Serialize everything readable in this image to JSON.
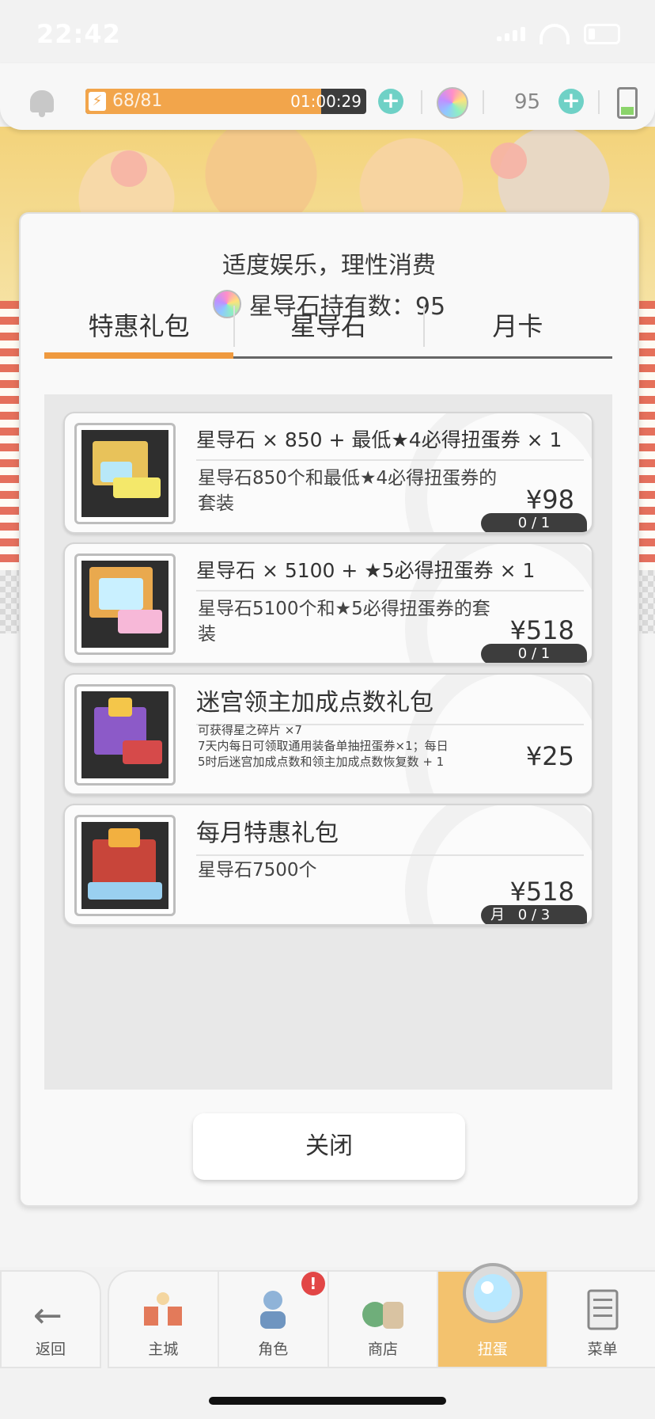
{
  "status_bar": {
    "time": "22:42"
  },
  "resources": {
    "stamina_text": "68/81",
    "stamina_fraction": 0.84,
    "stamina_timer": "01:00:29",
    "gem_count": "95"
  },
  "modal": {
    "notice": "适度娱乐，理性消费",
    "holding_label": "星导石持有数：95",
    "tabs": [
      {
        "label": "特惠礼包",
        "active": true
      },
      {
        "label": "星导石",
        "active": false
      },
      {
        "label": "月卡",
        "active": false
      }
    ],
    "items": [
      {
        "title": "星导石 × 850 + 最低★4必得扭蛋券 × 1",
        "desc": "星导石850个和最低★4必得扭蛋券的套装",
        "price": "¥98",
        "limit": "0 / 1",
        "limit_prefix": ""
      },
      {
        "title": "星导石 × 5100 + ★5必得扭蛋券 × 1",
        "desc": "星导石5100个和★5必得扭蛋券的套装",
        "price": "¥518",
        "limit": "0 / 1",
        "limit_prefix": ""
      },
      {
        "title": "迷宫领主加成点数礼包",
        "desc_lines": [
          "可获得星之碎片 ×7",
          "7天内每日可领取通用装备单抽扭蛋券×1；每日",
          "5时后迷宫加成点数和领主加成点数恢复数 + 1"
        ],
        "price": "¥25",
        "limit": ""
      },
      {
        "title": "每月特惠礼包",
        "desc": "星导石7500个",
        "price": "¥518",
        "limit": "0 / 3",
        "limit_prefix": "月"
      }
    ],
    "close_label": "关闭"
  },
  "nav": {
    "back_label": "返回",
    "items": [
      {
        "label": "主城",
        "icon": "castle-icon",
        "active": false
      },
      {
        "label": "角色",
        "icon": "character-icon",
        "active": false,
        "badge": "!"
      },
      {
        "label": "商店",
        "icon": "shop-bag-icon",
        "active": false
      },
      {
        "label": "扭蛋",
        "icon": "gacha-orb-icon",
        "active": true
      },
      {
        "label": "菜单",
        "icon": "menu-list-icon",
        "active": false
      }
    ]
  },
  "colors": {
    "accent": "#ef9a3f",
    "stamina": "#f2a54b",
    "plus": "#6fd1c6",
    "badge_bg": "#3d3d3d"
  }
}
